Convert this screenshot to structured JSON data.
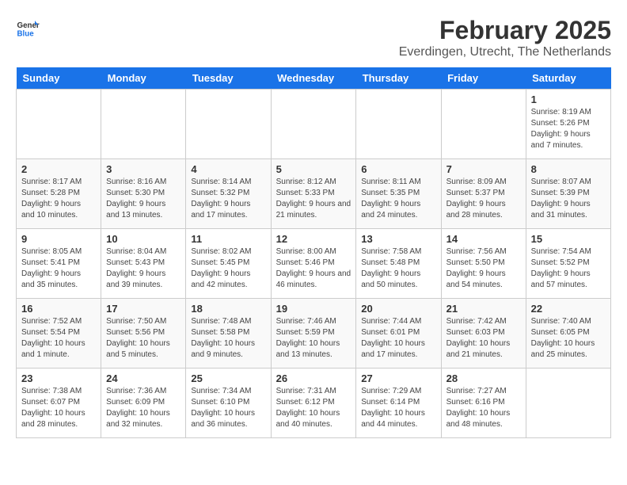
{
  "header": {
    "logo_line1": "General",
    "logo_line2": "Blue",
    "month_title": "February 2025",
    "subtitle": "Everdingen, Utrecht, The Netherlands"
  },
  "weekdays": [
    "Sunday",
    "Monday",
    "Tuesday",
    "Wednesday",
    "Thursday",
    "Friday",
    "Saturday"
  ],
  "weeks": [
    [
      {
        "day": "",
        "info": ""
      },
      {
        "day": "",
        "info": ""
      },
      {
        "day": "",
        "info": ""
      },
      {
        "day": "",
        "info": ""
      },
      {
        "day": "",
        "info": ""
      },
      {
        "day": "",
        "info": ""
      },
      {
        "day": "1",
        "info": "Sunrise: 8:19 AM\nSunset: 5:26 PM\nDaylight: 9 hours and 7 minutes."
      }
    ],
    [
      {
        "day": "2",
        "info": "Sunrise: 8:17 AM\nSunset: 5:28 PM\nDaylight: 9 hours and 10 minutes."
      },
      {
        "day": "3",
        "info": "Sunrise: 8:16 AM\nSunset: 5:30 PM\nDaylight: 9 hours and 13 minutes."
      },
      {
        "day": "4",
        "info": "Sunrise: 8:14 AM\nSunset: 5:32 PM\nDaylight: 9 hours and 17 minutes."
      },
      {
        "day": "5",
        "info": "Sunrise: 8:12 AM\nSunset: 5:33 PM\nDaylight: 9 hours and 21 minutes."
      },
      {
        "day": "6",
        "info": "Sunrise: 8:11 AM\nSunset: 5:35 PM\nDaylight: 9 hours and 24 minutes."
      },
      {
        "day": "7",
        "info": "Sunrise: 8:09 AM\nSunset: 5:37 PM\nDaylight: 9 hours and 28 minutes."
      },
      {
        "day": "8",
        "info": "Sunrise: 8:07 AM\nSunset: 5:39 PM\nDaylight: 9 hours and 31 minutes."
      }
    ],
    [
      {
        "day": "9",
        "info": "Sunrise: 8:05 AM\nSunset: 5:41 PM\nDaylight: 9 hours and 35 minutes."
      },
      {
        "day": "10",
        "info": "Sunrise: 8:04 AM\nSunset: 5:43 PM\nDaylight: 9 hours and 39 minutes."
      },
      {
        "day": "11",
        "info": "Sunrise: 8:02 AM\nSunset: 5:45 PM\nDaylight: 9 hours and 42 minutes."
      },
      {
        "day": "12",
        "info": "Sunrise: 8:00 AM\nSunset: 5:46 PM\nDaylight: 9 hours and 46 minutes."
      },
      {
        "day": "13",
        "info": "Sunrise: 7:58 AM\nSunset: 5:48 PM\nDaylight: 9 hours and 50 minutes."
      },
      {
        "day": "14",
        "info": "Sunrise: 7:56 AM\nSunset: 5:50 PM\nDaylight: 9 hours and 54 minutes."
      },
      {
        "day": "15",
        "info": "Sunrise: 7:54 AM\nSunset: 5:52 PM\nDaylight: 9 hours and 57 minutes."
      }
    ],
    [
      {
        "day": "16",
        "info": "Sunrise: 7:52 AM\nSunset: 5:54 PM\nDaylight: 10 hours and 1 minute."
      },
      {
        "day": "17",
        "info": "Sunrise: 7:50 AM\nSunset: 5:56 PM\nDaylight: 10 hours and 5 minutes."
      },
      {
        "day": "18",
        "info": "Sunrise: 7:48 AM\nSunset: 5:58 PM\nDaylight: 10 hours and 9 minutes."
      },
      {
        "day": "19",
        "info": "Sunrise: 7:46 AM\nSunset: 5:59 PM\nDaylight: 10 hours and 13 minutes."
      },
      {
        "day": "20",
        "info": "Sunrise: 7:44 AM\nSunset: 6:01 PM\nDaylight: 10 hours and 17 minutes."
      },
      {
        "day": "21",
        "info": "Sunrise: 7:42 AM\nSunset: 6:03 PM\nDaylight: 10 hours and 21 minutes."
      },
      {
        "day": "22",
        "info": "Sunrise: 7:40 AM\nSunset: 6:05 PM\nDaylight: 10 hours and 25 minutes."
      }
    ],
    [
      {
        "day": "23",
        "info": "Sunrise: 7:38 AM\nSunset: 6:07 PM\nDaylight: 10 hours and 28 minutes."
      },
      {
        "day": "24",
        "info": "Sunrise: 7:36 AM\nSunset: 6:09 PM\nDaylight: 10 hours and 32 minutes."
      },
      {
        "day": "25",
        "info": "Sunrise: 7:34 AM\nSunset: 6:10 PM\nDaylight: 10 hours and 36 minutes."
      },
      {
        "day": "26",
        "info": "Sunrise: 7:31 AM\nSunset: 6:12 PM\nDaylight: 10 hours and 40 minutes."
      },
      {
        "day": "27",
        "info": "Sunrise: 7:29 AM\nSunset: 6:14 PM\nDaylight: 10 hours and 44 minutes."
      },
      {
        "day": "28",
        "info": "Sunrise: 7:27 AM\nSunset: 6:16 PM\nDaylight: 10 hours and 48 minutes."
      },
      {
        "day": "",
        "info": ""
      }
    ]
  ]
}
